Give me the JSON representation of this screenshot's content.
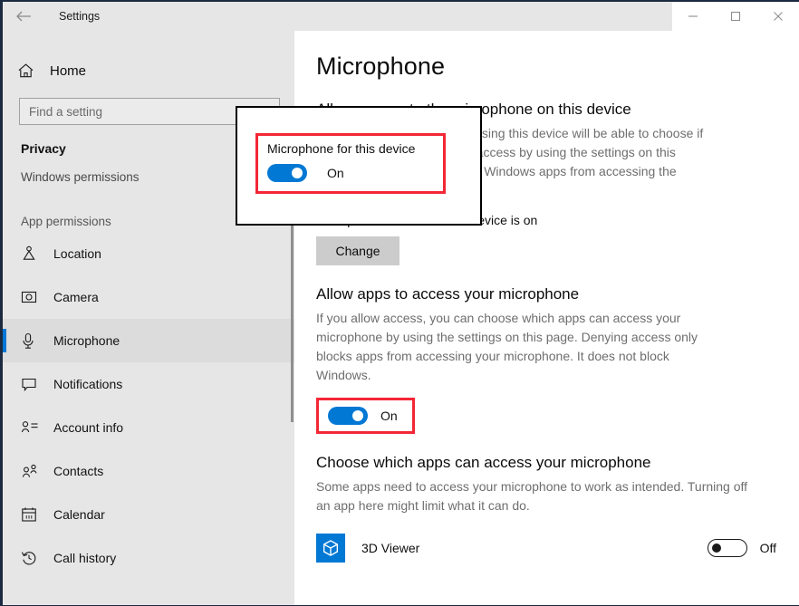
{
  "window": {
    "title": "Settings",
    "back_icon": "back-arrow-icon",
    "minimize_label": "—",
    "maximize_label": "□",
    "close_label": "✕"
  },
  "sidebar": {
    "home_label": "Home",
    "search_placeholder": "Find a setting",
    "search_value": "",
    "category": "Privacy",
    "windows_permissions_label": "Windows permissions",
    "app_permissions_header": "App permissions",
    "items": [
      {
        "label": "Location",
        "icon": "location-icon",
        "selected": false
      },
      {
        "label": "Camera",
        "icon": "camera-icon",
        "selected": false
      },
      {
        "label": "Microphone",
        "icon": "microphone-icon",
        "selected": true
      },
      {
        "label": "Notifications",
        "icon": "notification-icon",
        "selected": false
      },
      {
        "label": "Account info",
        "icon": "account-info-icon",
        "selected": false
      },
      {
        "label": "Contacts",
        "icon": "contacts-icon",
        "selected": false
      },
      {
        "label": "Calendar",
        "icon": "calendar-icon",
        "selected": false
      },
      {
        "label": "Call history",
        "icon": "call-history-icon",
        "selected": false
      }
    ]
  },
  "main": {
    "page_title": "Microphone",
    "device_section": {
      "heading": "Allow access to the microphone on this device",
      "body": "If you allow access, anyone using this device will be able to choose if their apps have microphone access by using the settings on this page. Denying access blocks Windows apps from accessing the microphone.",
      "status": "Microphone access for this device is on",
      "change_button": "Change"
    },
    "apps_section": {
      "heading": "Allow apps to access your microphone",
      "body": "If you allow access, you can choose which apps can access your microphone by using the settings on this page. Denying access only blocks apps from accessing your microphone. It does not block Windows.",
      "toggle_state": "On"
    },
    "choose_section": {
      "heading": "Choose which apps can access your microphone",
      "body": "Some apps need to access your microphone to work as intended. Turning off an app here might limit what it can do.",
      "apps": [
        {
          "name": "3D Viewer",
          "icon": "cube-icon",
          "toggle_state": "Off"
        }
      ]
    }
  },
  "callout": {
    "label": "Microphone for this device",
    "toggle_state": "On"
  },
  "colors": {
    "accent": "#0078d4",
    "annotation": "#f32735",
    "sidebar_bg": "#e6e6e6",
    "window_border": "#1b2a41"
  }
}
